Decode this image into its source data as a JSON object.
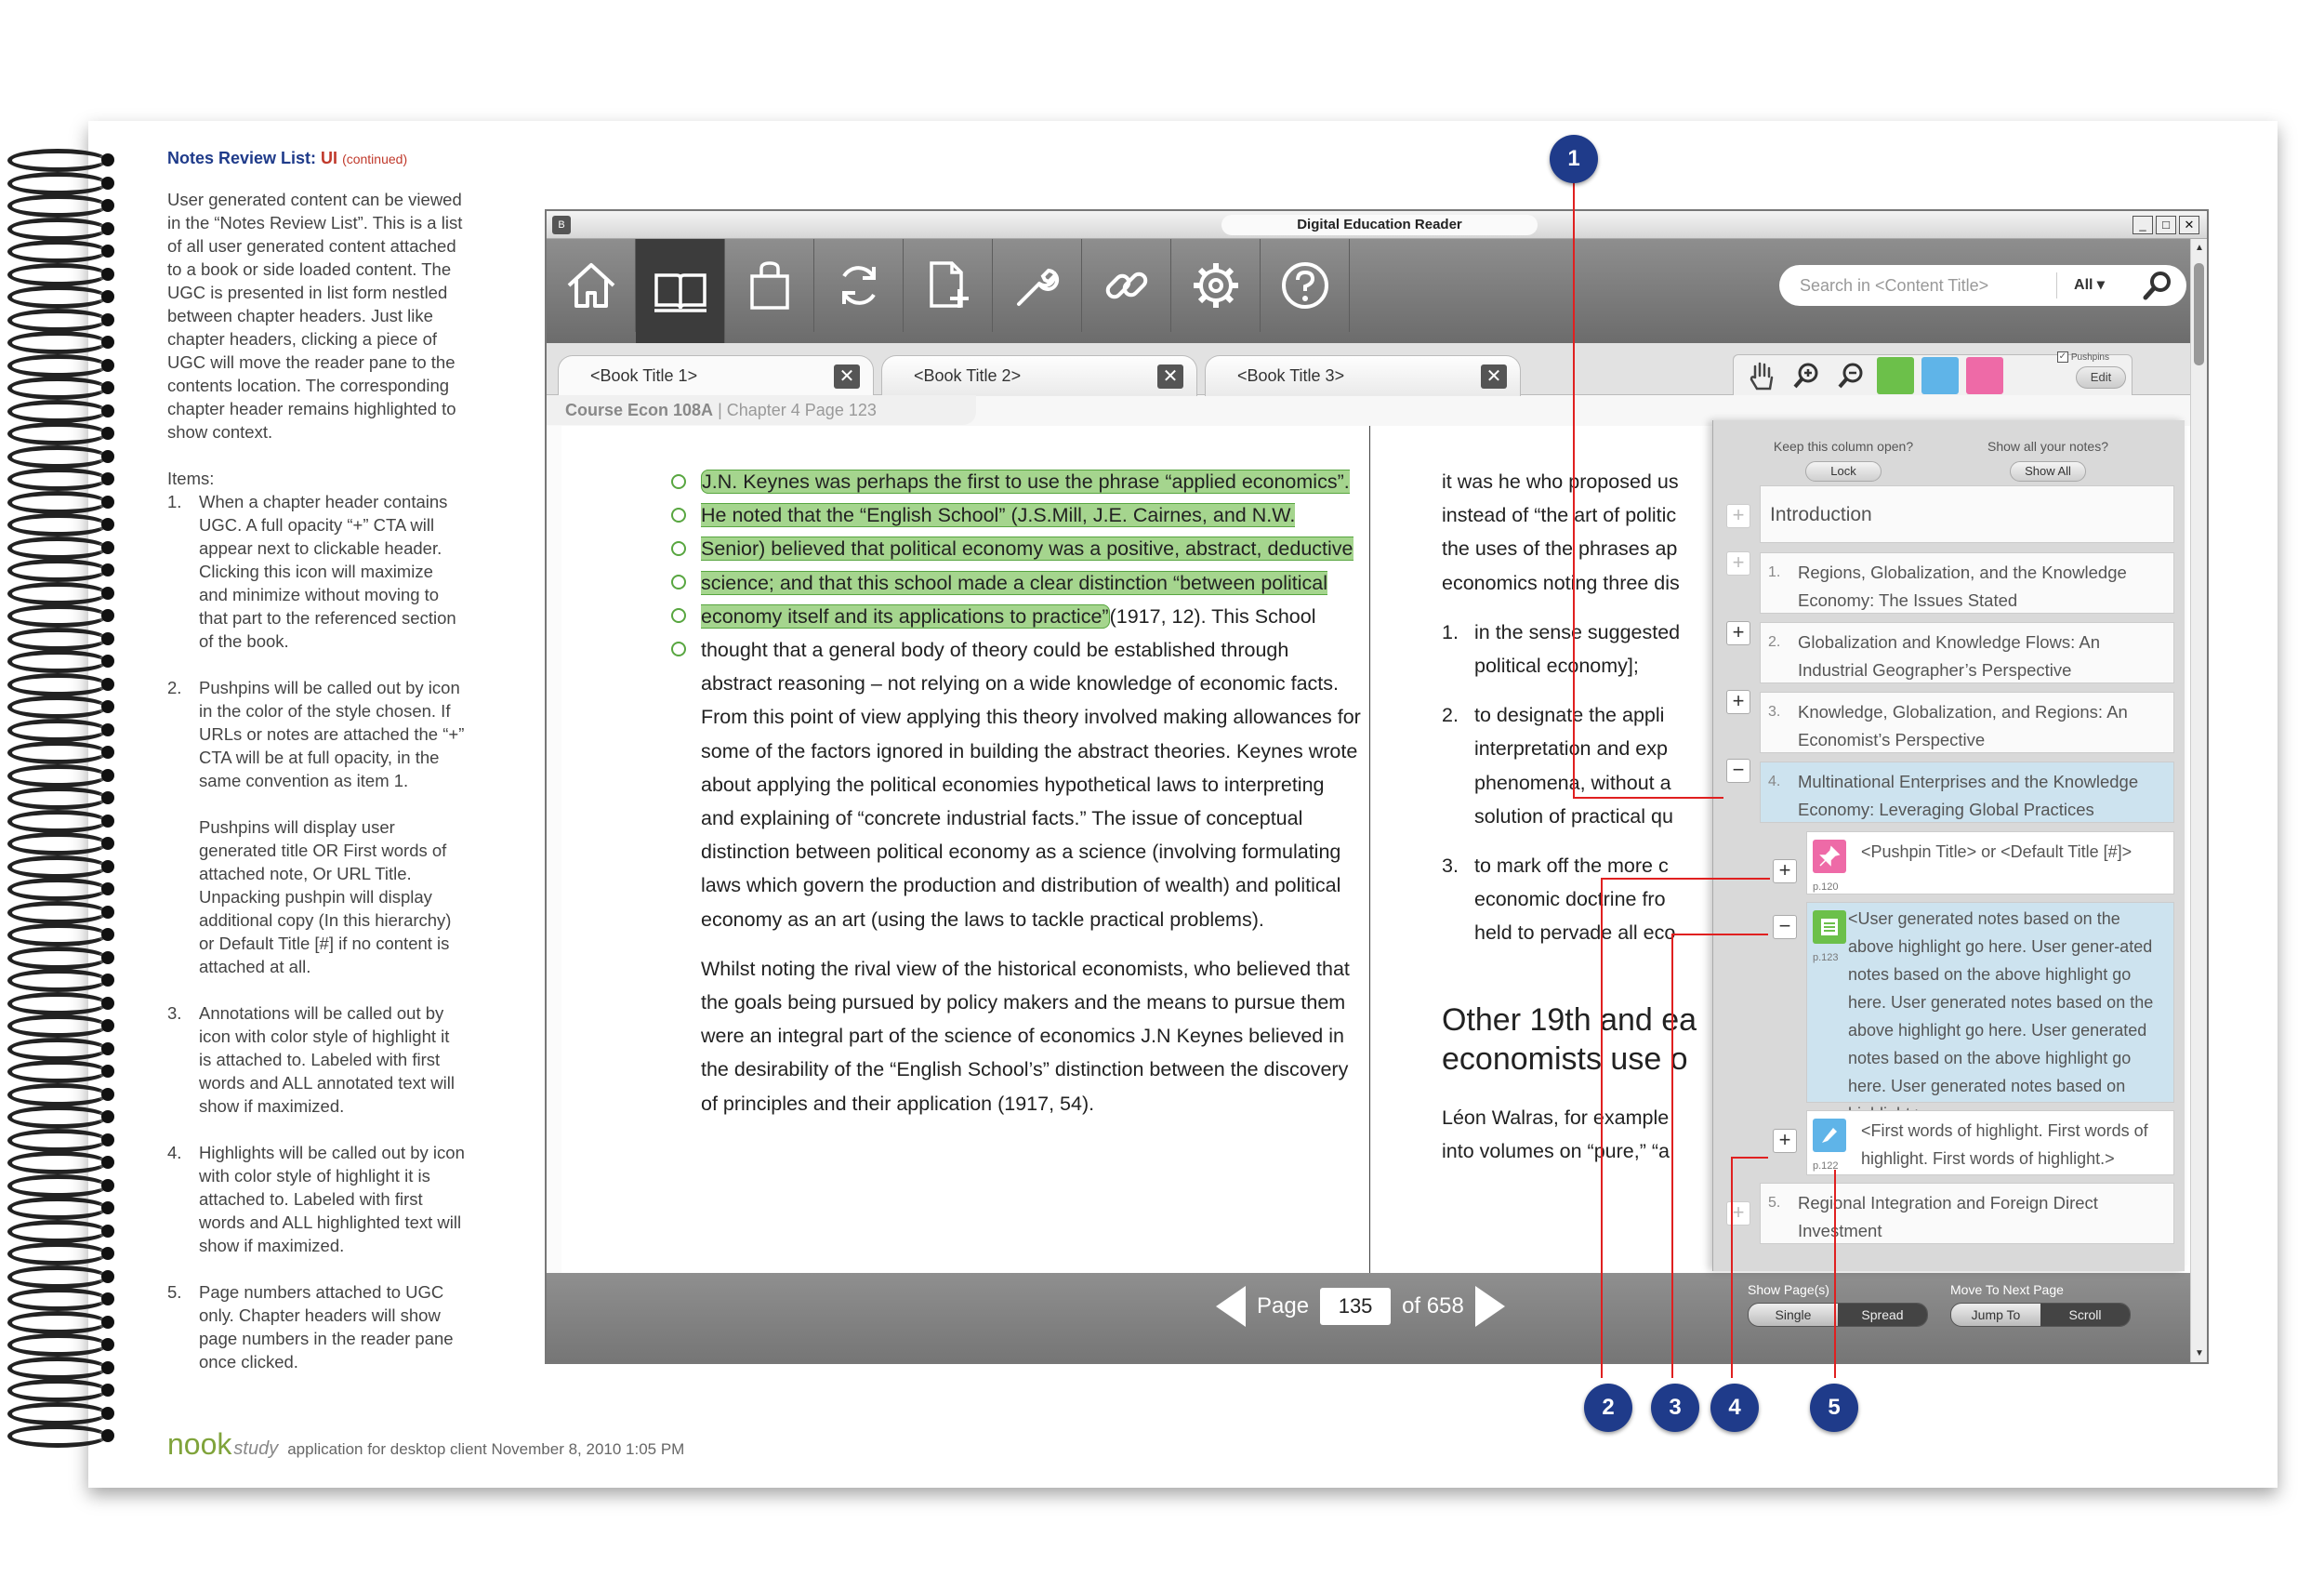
{
  "sidebar_doc": {
    "heading": "Notes Review List: ",
    "heading_ui": "UI",
    "heading_cont": "(continued)",
    "intro": "User generated content can be viewed in the “Notes Review List”. This is a list of all user generated content attached to a book or side loaded content. The UGC is presented in list form  nestled between chapter headers. Just like chapter headers, clicking a piece of UGC will move the reader pane to the contents location. The corresponding chapter header remains highlighted to show context.",
    "items_label": "Items:",
    "items": [
      {
        "n": "1.",
        "text": "When a chapter header contains UGC. A full opacity “+” CTA will appear next to clickable header. Clicking this icon will maximize and minimize without moving to that part to the referenced section of the book."
      },
      {
        "n": "2.",
        "text": "Pushpins will be called out by icon in the color of the style chosen. If URLs or notes are attached the “+” CTA will be at full opacity, in the same convention as item 1.",
        "extra": "Pushpins will display user generated title OR First words of attached note, Or URL Title. Unpacking pushpin will display additional copy (In this hierarchy) or Default Title [#] if no content is attached at all."
      },
      {
        "n": "3.",
        "text": "Annotations will be called out by icon with color style of highlight it is attached to. Labeled with first words and ALL annotated text will show if maximized."
      },
      {
        "n": "4.",
        "text": "Highlights will be called out by icon with color style of highlight it is attached to. Labeled with first words and ALL highlighted text will show if maximized."
      },
      {
        "n": "5.",
        "text": "Page numbers attached to UGC only. Chapter headers will show page numbers in the reader pane once clicked."
      }
    ],
    "footer_logo1": "nook",
    "footer_logo2": "study",
    "footer_text": "application for desktop client  November 8, 2010 1:05 PM"
  },
  "window": {
    "title": "Digital Education Reader",
    "btn_min": "_",
    "btn_max": "□",
    "btn_close": "✕",
    "search_placeholder": "Search in <Content Title>",
    "search_scope": "All ▾",
    "tabs": [
      "<Book Title 1>",
      "<Book Title 2>",
      "<Book Title 3>"
    ],
    "tab_close": "✕",
    "pushpins_label": "Pushpins",
    "edit_label": "Edit",
    "crumb_course": "Course Econ 108A",
    "crumb_rest": " | Chapter 4 Page 123"
  },
  "left_page": {
    "highlight": "J.N. Keynes was perhaps the first to use the phrase “applied economics”. He noted that the “English School” (J.S.Mill, J.E. Cairnes, and N.W. Senior) believed that political economy was a positive, abstract, deductive science; and that this school made a clear distinction “between political economy itself and its applications to practice”",
    "para1_rest": "(1917, 12). This School thought that a general body of theory could be established through abstract reasoning – not relying on a wide knowledge of economic facts. From this point of view applying this theory involved making allowances for some of the factors ignored in building the abstract theories. Keynes wrote about applying the political economies hypothetical laws to interpreting and explaining of “concrete industrial facts.” The issue of conceptual distinction between political economy as a science (involving formulating laws which govern the production and distribution of wealth) and political economy as an art (using the laws to tackle practical problems).",
    "para2": "Whilst noting the rival view of the historical economists, who believed that the goals being pursued by policy makers and the means to pursue them were an integral part of the science of economics J.N Keynes believed in the desirability of the “English School’s” distinction between the discovery of principles and their application (1917, 54)."
  },
  "right_page": {
    "lines": [
      "it was he who proposed us",
      "instead of “the art of politic",
      "the uses of the phrases ap",
      "economics noting three dis"
    ],
    "list": [
      {
        "n": "1.",
        "lines": [
          "in the sense suggested",
          "political economy];"
        ]
      },
      {
        "n": "2.",
        "lines": [
          "to designate the appli",
          "interpretation and exp",
          "phenomena, without a",
          "solution of practical qu"
        ]
      },
      {
        "n": "3.",
        "lines": [
          "to mark off the more c",
          "economic doctrine fro",
          "held to pervade all eco"
        ]
      }
    ],
    "heading_lines": [
      "Other 19th and ea",
      "economists use o"
    ],
    "tail_lines": [
      "Léon Walras, for example",
      "into volumes on “pure,” “a"
    ]
  },
  "pager": {
    "label": "Page",
    "value": "135",
    "of": "of 658"
  },
  "show_pages": {
    "label": "Show Page(s)",
    "single": "Single",
    "spread": "Spread"
  },
  "move_next": {
    "label": "Move To Next Page",
    "jump": "Jump To",
    "scroll": "Scroll"
  },
  "notes_panel": {
    "keep_label": "Keep this column open?",
    "lock": "Lock",
    "show_label": "Show all your notes?",
    "show_all": "Show All",
    "introduction": "Introduction",
    "ch1": {
      "n": "1.",
      "title": "Regions, Globalization, and the Knowledge Economy: The Issues Stated"
    },
    "ch2": {
      "n": "2.",
      "title": "Globalization and Knowledge Flows: An Industrial Geographer’s Perspective"
    },
    "ch3": {
      "n": "3.",
      "title": "Knowledge, Globalization, and Regions: An Economist’s Perspective"
    },
    "ch4": {
      "n": "4.",
      "title": "Multinational Enterprises and the Knowledge Economy: Leveraging Global Practices"
    },
    "pin": {
      "title": "<Pushpin Title> or <Default Title [#]>",
      "page": "p.120"
    },
    "note": {
      "text": "<User generated notes based on the above highlight go here. User gener-ated notes based on the above highlight go here. User generated notes based on the above highlight go here.  User generated notes based on the above highlight go here. User generated notes based on highlight.>",
      "page": "p.123"
    },
    "hl": {
      "text": "<First words of highlight. First words of highlight. First words of highlight.>",
      "page": "p.122"
    },
    "ch5": {
      "n": "5.",
      "title": "Regional Integration and Foreign Direct Investment"
    },
    "plus": "+",
    "minus": "−"
  },
  "callouts": [
    "1",
    "2",
    "3",
    "4",
    "5"
  ],
  "colors": {
    "callout": "#1f3b8a",
    "line": "#e02020",
    "highlight": "#a5d58e",
    "pin_pink": "#ee6aa7",
    "note_green": "#6cc04a",
    "hl_blue": "#5fb4e8"
  }
}
